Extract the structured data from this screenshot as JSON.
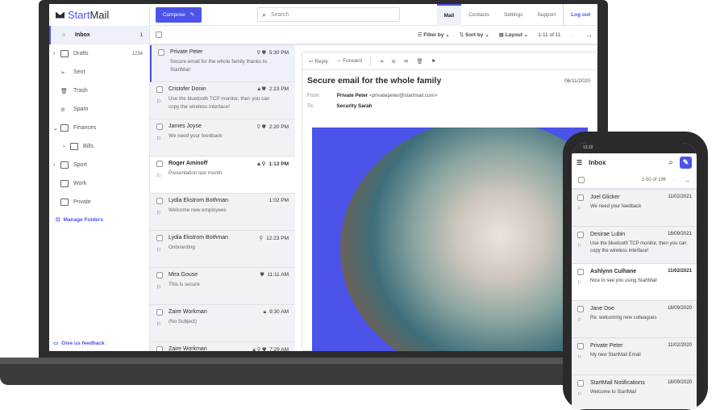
{
  "app": {
    "brand_a": "Start",
    "brand_b": "Mail",
    "compose": "Compose",
    "search_placeholder": "Search"
  },
  "nav": [
    "Mail",
    "Contacts",
    "Settings",
    "Support",
    "Log out"
  ],
  "toolbar": {
    "filter": "Filter by ⌄",
    "sort": "Sort by ⌄",
    "layout": "Layout ⌄",
    "range": "1-11 of 11"
  },
  "folders": [
    {
      "label": "Inbox",
      "count": "1",
      "caret": ""
    },
    {
      "label": "Drafts",
      "count": "1234",
      "caret": "›"
    },
    {
      "label": "Sent",
      "count": "",
      "caret": ""
    },
    {
      "label": "Trash",
      "count": "",
      "caret": ""
    },
    {
      "label": "Spam",
      "count": "",
      "caret": ""
    },
    {
      "label": "Finances",
      "count": "",
      "caret": "⌄"
    },
    {
      "label": "Bills",
      "count": "",
      "caret": "›"
    },
    {
      "label": "Sport",
      "count": "",
      "caret": "›"
    },
    {
      "label": "Work",
      "count": "",
      "caret": ""
    },
    {
      "label": "Private",
      "count": "",
      "caret": ""
    }
  ],
  "manage_folders": "Manage Folders",
  "feedback": "Give us feedback",
  "emails": [
    {
      "from": "Private Peter",
      "time": "5:30 PM",
      "icons": "⚲ ⛊",
      "subject": "Secure email for the whole family thanks to StartMail"
    },
    {
      "from": "Cristofer Donin",
      "time": "2:23 PM",
      "icons": "🔒︎ ⛊",
      "subject": "Use the bluetooth TCP monitor, then you can copy the wireless interface!"
    },
    {
      "from": "James Joyse",
      "time": "2:20 PM",
      "icons": "⚲ ⛊",
      "subject": "We need your feedback"
    },
    {
      "from": "Roger Aminoff",
      "time": "1:13 PM",
      "icons": "🔒︎ ⚲",
      "subject": "Presentation last month"
    },
    {
      "from": "Lydia Ekstrom Bothman",
      "time": "1:02 PM",
      "icons": "",
      "subject": "Welcome new employees"
    },
    {
      "from": "Lydia Ekstrom Bothman",
      "time": "12:23 PM",
      "icons": "⚲",
      "subject": "Onboarding"
    },
    {
      "from": "Mira Gouse",
      "time": "11:11 AM",
      "icons": "⛊",
      "subject": "This is secure"
    },
    {
      "from": "Zaire Workman",
      "time": "9:30 AM",
      "icons": "🔒︎",
      "subject": "(No Subject)"
    },
    {
      "from": "Zaire Workman",
      "time": "7:29 AM",
      "icons": "🔒︎ ⚲ ⛊",
      "subject": ""
    }
  ],
  "reader": {
    "reply": "Reply",
    "forward": "Forward",
    "subject": "Secure email for the whole family",
    "date": "06/11/2020",
    "from_label": "From",
    "from_name": "Private Peter",
    "from_email": "<privatepeter@startmail.com>",
    "to_label": "To:",
    "to_name": "Security Sarah"
  },
  "phone": {
    "clock": "12:22",
    "title": "Inbox",
    "range": "1-50 of 196",
    "emails": [
      {
        "from": "Joel Glicker",
        "date": "11/02/2021",
        "subject": "We need your feedback"
      },
      {
        "from": "Desirae Lubin",
        "date": "18/09/2021",
        "subject": "Use the bluetooth TCP monitor, then you can copy the wireless interface!"
      },
      {
        "from": "Ashlynn Culhane",
        "date": "11/02/2021",
        "subject": "Nice to see you using StartMail"
      },
      {
        "from": "Jane Doe",
        "date": "18/09/2020",
        "subject": "Re: welcoming new colleagues"
      },
      {
        "from": "Private Peter",
        "date": "11/02/2020",
        "subject": "My new StartMail Email"
      },
      {
        "from": "StartMail Notifications",
        "date": "18/09/2020",
        "subject": "Welcome to StartMail"
      }
    ]
  },
  "colors": {
    "accent": "#4b53e8"
  }
}
